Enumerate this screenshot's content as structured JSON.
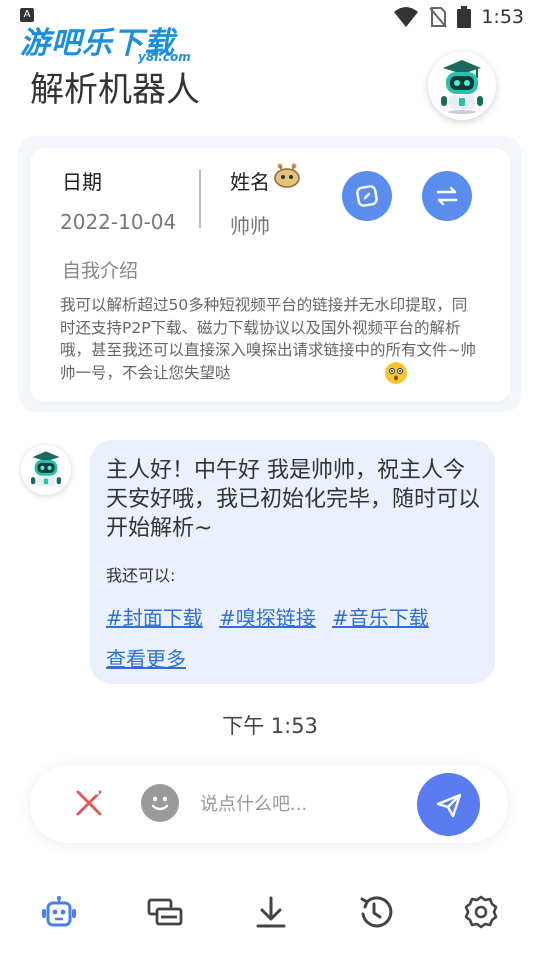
{
  "status_bar": {
    "time": "1:53",
    "indicator": "A"
  },
  "watermark": {
    "main": "游吧乐下载",
    "sub": "y8l.com"
  },
  "header": {
    "title": "解析机器人"
  },
  "profile": {
    "date_label": "日期",
    "date_value": "2022-10-04",
    "name_label": "姓名",
    "name_value": "帅帅",
    "intro_label": "自我介绍",
    "intro_text": "我可以解析超过50多种短视频平台的链接并无水印提取，同时还支持P2P下载、磁力下载协议以及国外视频平台的解析哦，甚至我还可以直接深入嗅探出请求链接中的所有文件~帅帅一号，不会让您失望哒"
  },
  "chat": {
    "greeting": "主人好！中午好 我是帅帅，祝主人今天安好哦，我已初始化完毕，随时可以开始解析~",
    "can_do_label": "我还可以:",
    "tags": [
      "#封面下载",
      "#嗅探链接",
      "#音乐下载"
    ],
    "more_label": "查看更多",
    "time": "下午 1:53"
  },
  "input": {
    "placeholder": "说点什么吧..."
  },
  "colors": {
    "accent": "#5b8def",
    "send": "#5b7bf0",
    "link": "#2f6fd6",
    "bubble": "#eaf1fc",
    "clear_icon": "#e25b5b"
  },
  "nav": {
    "items": [
      "robot-icon",
      "cards-icon",
      "download-icon",
      "history-icon",
      "settings-icon"
    ]
  }
}
